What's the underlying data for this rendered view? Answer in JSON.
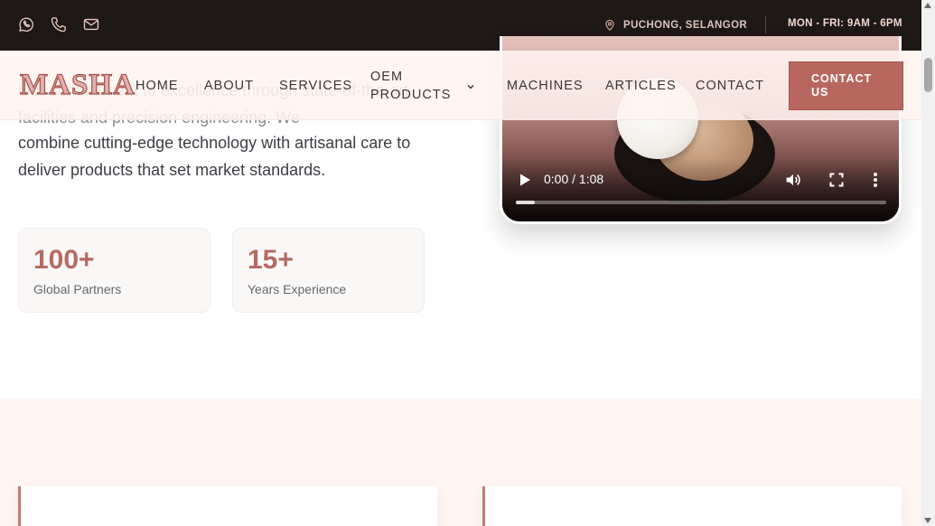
{
  "topbar": {
    "icons": [
      "whatsapp-icon",
      "phone-icon",
      "mail-icon"
    ],
    "location": "PUCHONG, SELANGOR",
    "hours": "MON - FRI: 9AM - 6PM"
  },
  "nav": {
    "logo": "MASHA",
    "items": {
      "home": "HOME",
      "about": "ABOUT",
      "services": "SERVICES",
      "oem": "OEM PRODUCTS",
      "machines": "MACHINES",
      "articles": "ARTICLES",
      "contact": "CONTACT"
    },
    "cta": "CONTACT US"
  },
  "intro": {
    "hidden_text": "Our commitment to excellence through state-of-the-art facilities and precision engineering. We",
    "text": "combine cutting-edge technology with artisanal care to deliver products that set market standards."
  },
  "stats": [
    {
      "value": "100+",
      "label": "Global Partners"
    },
    {
      "value": "15+",
      "label": "Years Experience"
    }
  ],
  "video": {
    "time": "0:00 / 1:08",
    "progress": 0.05
  },
  "colors": {
    "accent": "#b8675f",
    "topbar_bg": "#1e1917",
    "section_bg": "#fff6f3"
  }
}
